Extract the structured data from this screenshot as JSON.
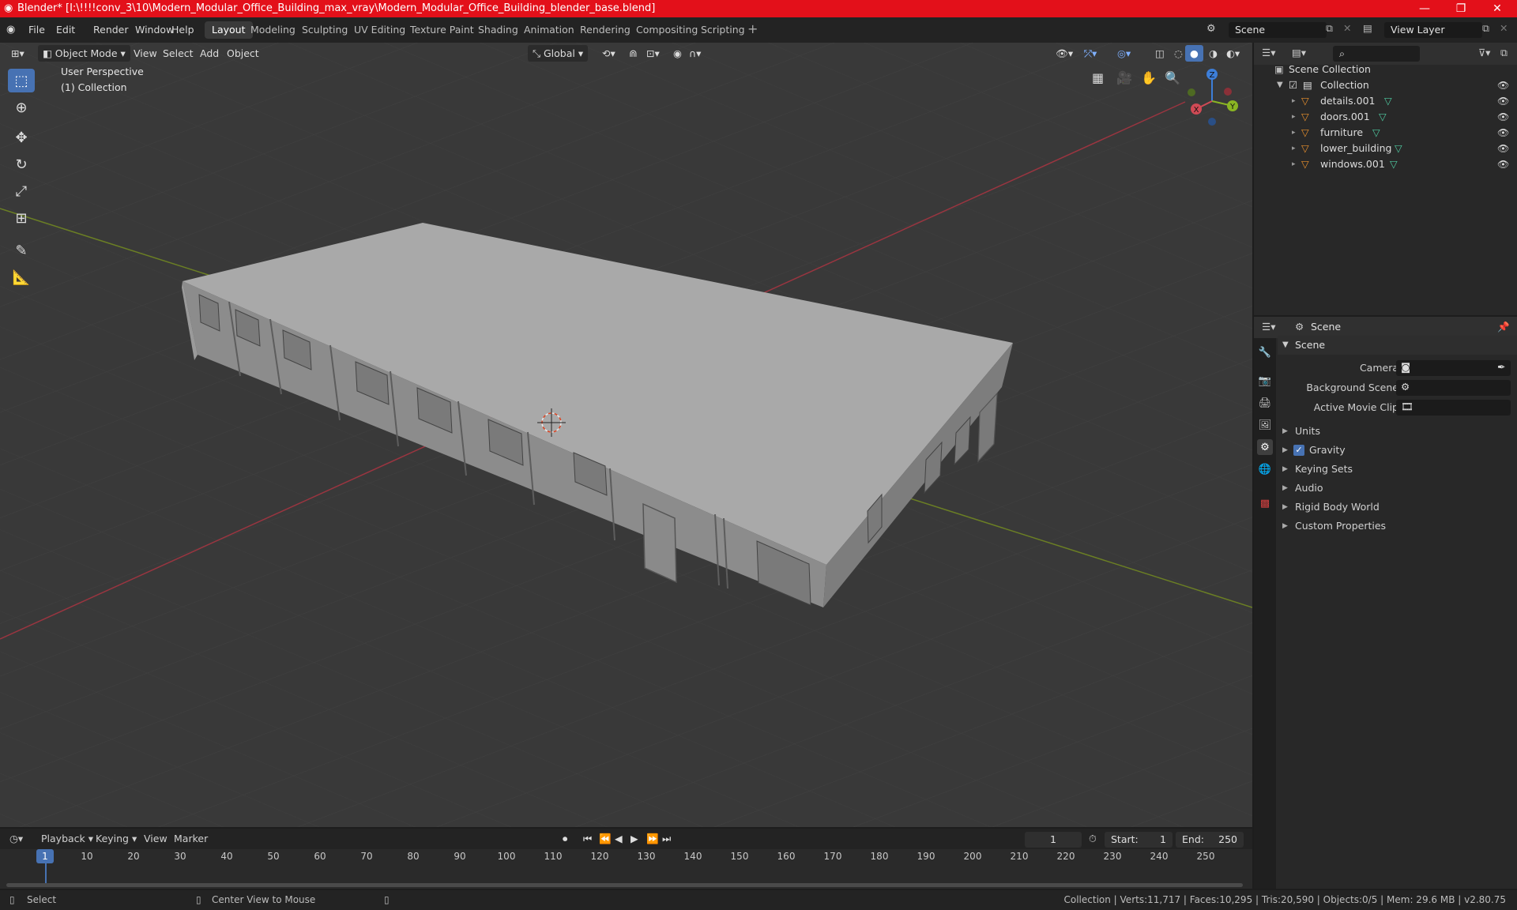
{
  "window": {
    "title": "Blender* [I:\\!!!!conv_3\\10\\Modern_Modular_Office_Building_max_vray\\Modern_Modular_Office_Building_blender_base.blend]"
  },
  "menus": [
    "File",
    "Edit",
    "Render",
    "Window",
    "Help"
  ],
  "workspaces": [
    "Layout",
    "Modeling",
    "Sculpting",
    "UV Editing",
    "Texture Paint",
    "Shading",
    "Animation",
    "Rendering",
    "Compositing",
    "Scripting"
  ],
  "scene_field": "Scene",
  "viewlayer_field": "View Layer",
  "viewport_header": {
    "mode": "Object Mode",
    "menus": [
      "View",
      "Select",
      "Add",
      "Object"
    ],
    "orientation": "Global"
  },
  "viewport": {
    "perspective": "User Perspective",
    "collection": "(1) Collection"
  },
  "outliner": {
    "root": "Scene Collection",
    "collection": "Collection",
    "items": [
      "details.001",
      "doors.001",
      "furniture",
      "lower_building",
      "windows.001"
    ]
  },
  "properties": {
    "breadcrumb": "Scene",
    "panel_title": "Scene",
    "camera_label": "Camera",
    "background_label": "Background Scene",
    "movieclip_label": "Active Movie Clip",
    "sections": [
      "Units",
      "Gravity",
      "Keying Sets",
      "Audio",
      "Rigid Body World",
      "Custom Properties"
    ],
    "gravity_checked": true
  },
  "timeline": {
    "menus": [
      "Playback",
      "Keying",
      "View",
      "Marker"
    ],
    "current_frame": "1",
    "start_label": "Start:",
    "start": "1",
    "end_label": "End:",
    "end": "250",
    "ticks": [
      "1",
      "10",
      "20",
      "30",
      "40",
      "50",
      "60",
      "70",
      "80",
      "90",
      "100",
      "110",
      "120",
      "130",
      "140",
      "150",
      "160",
      "170",
      "180",
      "190",
      "200",
      "210",
      "220",
      "230",
      "240",
      "250"
    ]
  },
  "statusbar": {
    "select": "Select",
    "center": "Center View to Mouse",
    "stats": "Collection | Verts:11,717 | Faces:10,295 | Tris:20,590 | Objects:0/5 | Mem: 29.6 MB | v2.80.75"
  },
  "colors": {
    "accent": "#4772b3",
    "titlebar": "#e3101a",
    "x_axis": "#d04a55",
    "y_axis": "#8ab523",
    "z_axis": "#3d7ed8"
  }
}
